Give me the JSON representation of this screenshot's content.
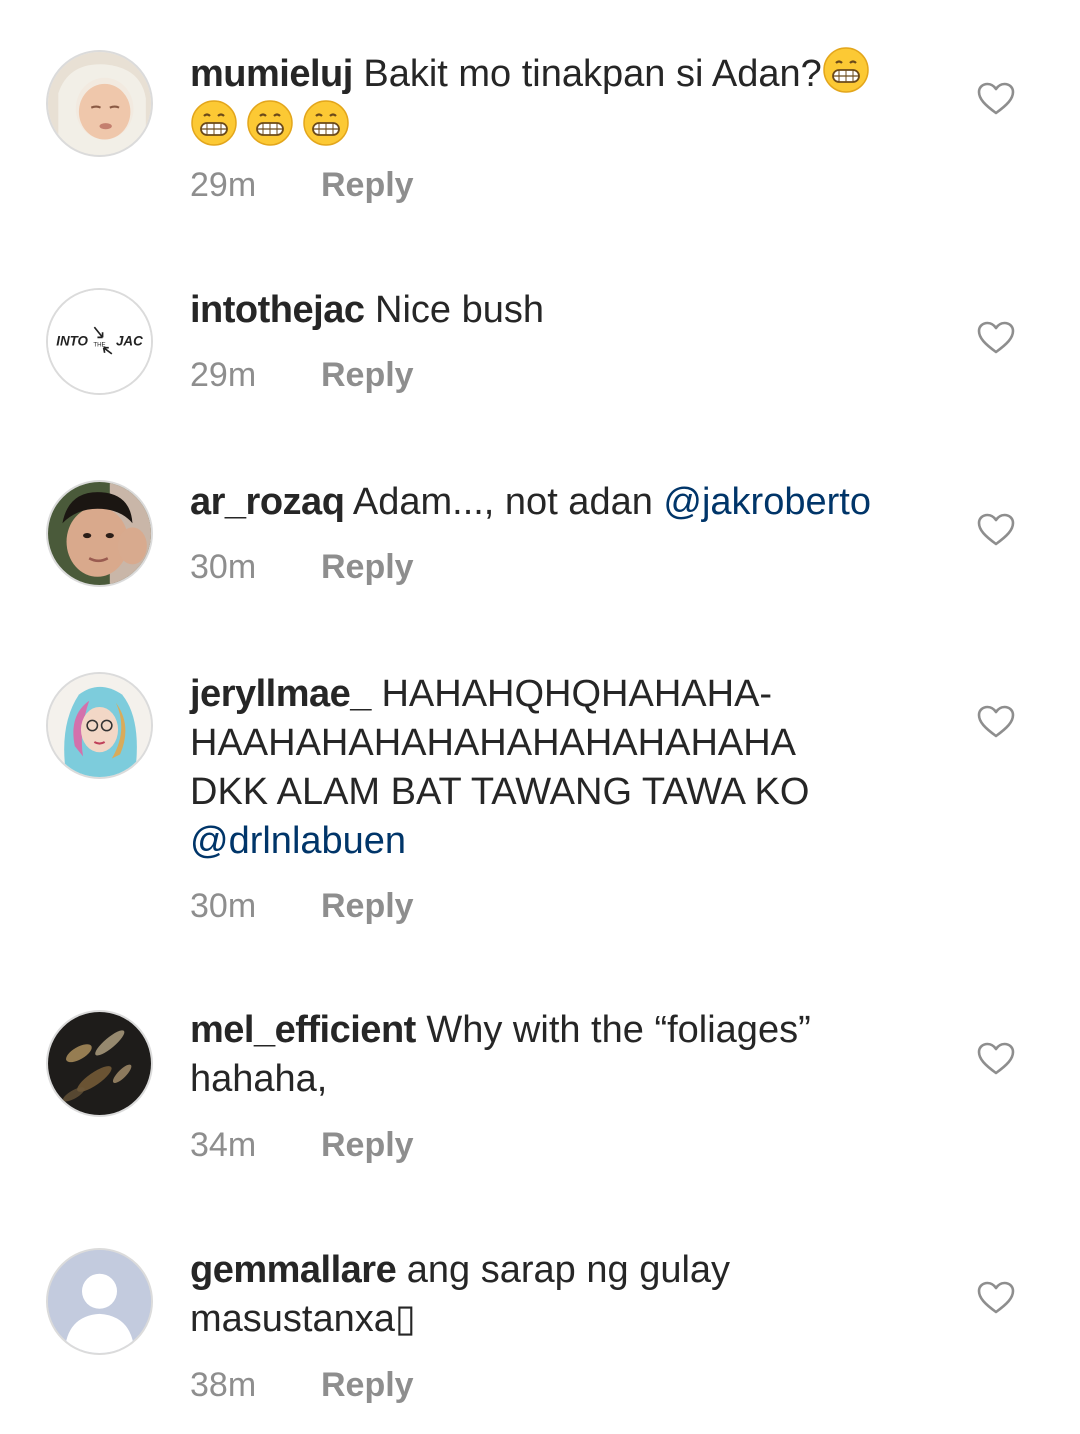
{
  "comments": [
    {
      "username": "mumieluj",
      "text": " Bakit mo tinakpan si Adan?",
      "emoji": "grinning-face-icon",
      "time": "29m",
      "reply": "Reply"
    },
    {
      "username": "intothejac",
      "text": " Nice bush",
      "time": "29m",
      "reply": "Reply"
    },
    {
      "username": "ar_rozaq",
      "text": " Adam..., not adan ",
      "mention": "@jakroberto",
      "time": "30m",
      "reply": "Reply"
    },
    {
      "username": "jeryllmae_",
      "text_lines": [
        " HAHAHQHQHAHAHA-",
        "HAAHAHAHAHAHAHAHAHAHAHA",
        "DKK ALAM BAT TAWANG TAWA KO"
      ],
      "mention": "@drlnlabuen",
      "time": "30m",
      "reply": "Reply"
    },
    {
      "username": "mel_efficient",
      "text_lines": [
        " Why with the “foliages”",
        "hahaha,"
      ],
      "time": "34m",
      "reply": "Reply"
    },
    {
      "username": "gemmallare",
      "text_lines": [
        " ang sarap ng gulay",
        "masustanxa"
      ],
      "trailing_glyph": "▯",
      "time": "38m",
      "reply": "Reply"
    }
  ],
  "avatar_logo_text": "INTO THE JAC",
  "colors": {
    "text": "#262626",
    "secondary": "#8e8e8e",
    "mention": "#003569",
    "heart_stroke": "#8e8e8e"
  }
}
